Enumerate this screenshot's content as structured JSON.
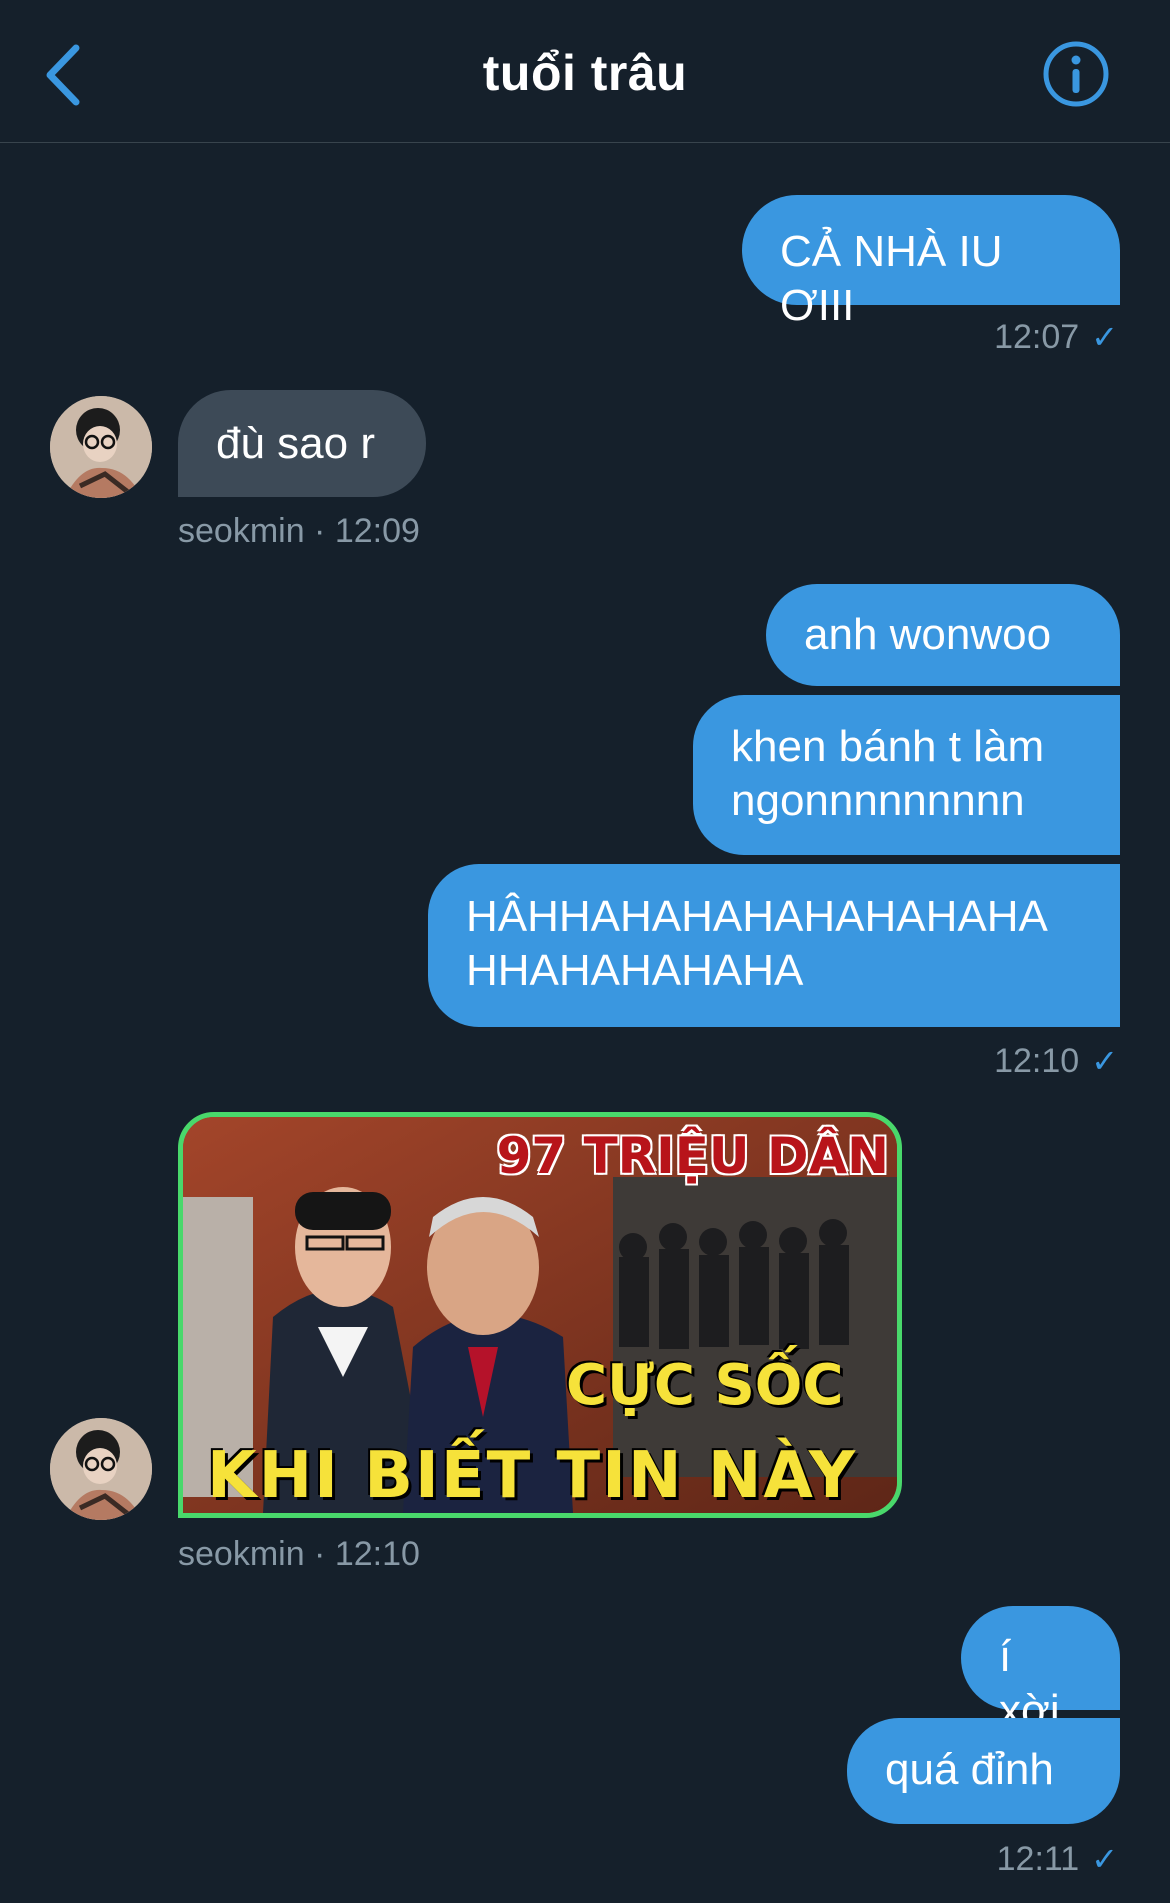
{
  "header": {
    "title": "tuổi trâu",
    "back_icon": "chevron-left-icon",
    "info_icon": "info-icon",
    "accent": "#3a97e0"
  },
  "messages": [
    {
      "direction": "out",
      "text": "CẢ NHÀ IU ƠIII"
    },
    {
      "direction": "out_meta",
      "time": "12:07",
      "status": "✓"
    },
    {
      "direction": "in",
      "text": "đù sao r"
    },
    {
      "direction": "in_meta",
      "sender_time": "seokmin · 12:09"
    },
    {
      "direction": "out",
      "text": "anh wonwoo"
    },
    {
      "direction": "out",
      "text": "khen bánh t làm ngonnnnnnnnn"
    },
    {
      "direction": "out",
      "text": "HÂHHAHAHAHAHAHAHAHA HHAHAHAHAHA"
    },
    {
      "direction": "out_meta",
      "time": "12:10",
      "status": "✓"
    },
    {
      "direction": "in_media",
      "overlay_top": "97 TRIỆU DÂN",
      "overlay_mid": "CỰC SỐC",
      "overlay_bottom": "KHI BIẾT TIN NÀY"
    },
    {
      "direction": "in_meta",
      "sender_time": "seokmin · 12:10"
    },
    {
      "direction": "out",
      "text": "í xời"
    },
    {
      "direction": "out",
      "text": "quá đỉnh"
    },
    {
      "direction": "out_meta",
      "time": "12:11",
      "status": "✓"
    }
  ]
}
